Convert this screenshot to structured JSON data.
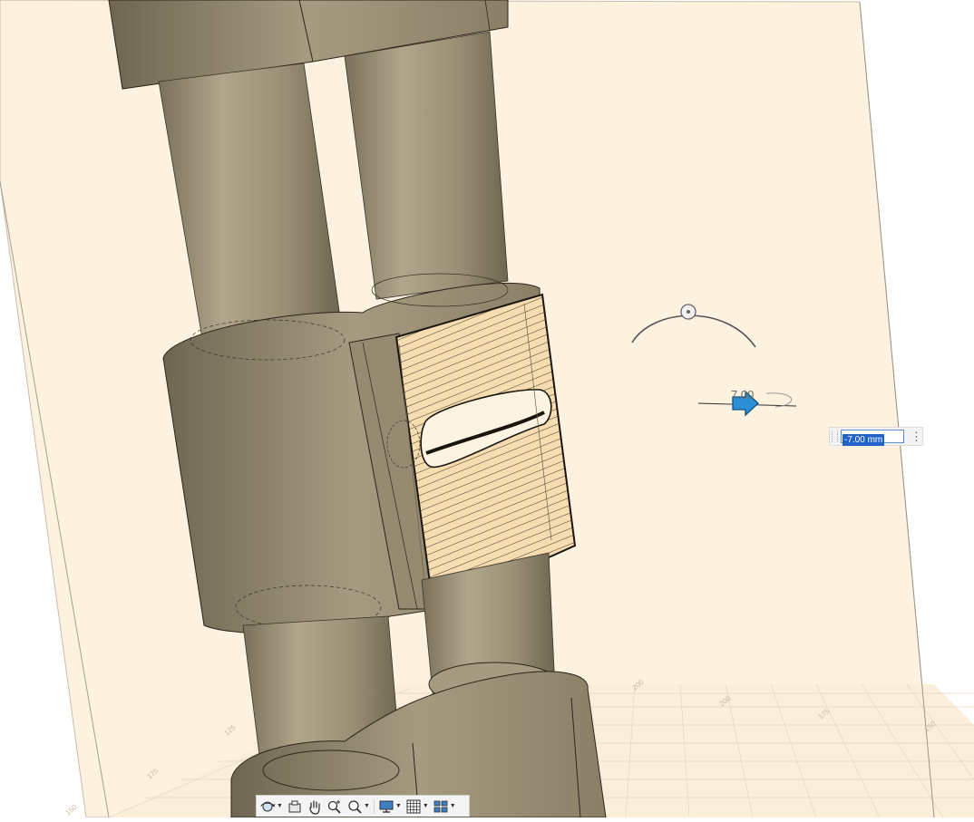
{
  "viewport": {
    "background_color": "#ffffff",
    "sketch_plane_color": "#fdf1df",
    "body_color": "#8e846c",
    "selected_face_color": "#f6dcb1",
    "manipulator_color": "#2b8fd8"
  },
  "dimension": {
    "label": "7.00",
    "input_value": "-7.00 mm",
    "more_icon": "more-vertical-icon"
  },
  "grid_labels": [
    "200",
    "200",
    "175",
    "150",
    "125",
    "175",
    "150"
  ],
  "toolbar": {
    "items": [
      {
        "icon": "orbit-icon",
        "has_menu": true
      },
      {
        "icon": "look-at-icon",
        "has_menu": false
      },
      {
        "icon": "pan-hand-icon",
        "has_menu": false
      },
      {
        "icon": "zoom-icon",
        "has_menu": false
      },
      {
        "icon": "fit-view-icon",
        "has_menu": true
      },
      {
        "icon": "display-settings-icon",
        "has_menu": true
      },
      {
        "icon": "grid-icon",
        "has_menu": true
      },
      {
        "icon": "viewports-icon",
        "has_menu": true
      }
    ]
  }
}
